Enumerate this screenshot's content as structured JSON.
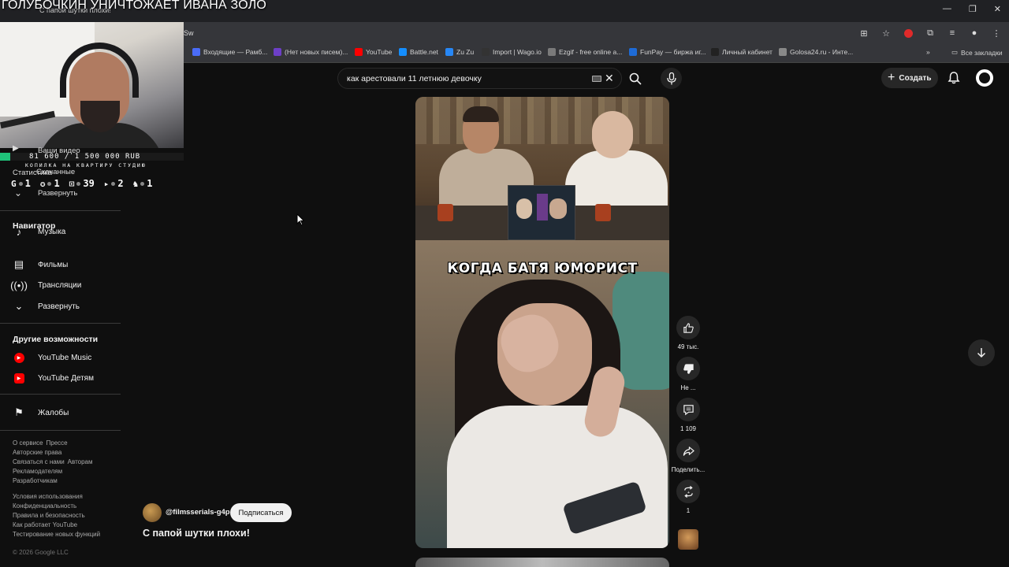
{
  "stream": {
    "title": "ГОЛУБОЧКИН УНИЧТОЖАЕТ ИВАНА ЗОЛО",
    "donation_amount": "81 600 / 1 500 000 RUB",
    "donation_progress": 0.0544,
    "donation_goal": "КОПИЛКА НА КВАРТИРУ СТУДИЮ",
    "stats": [
      {
        "icon": "G",
        "value": "1"
      },
      {
        "icon": "✪",
        "value": "1"
      },
      {
        "icon": "⊡",
        "value": "39"
      },
      {
        "icon": "▸",
        "value": "2"
      },
      {
        "icon": "♞",
        "value": "1"
      }
    ]
  },
  "browser": {
    "tab_title": "С папой шутки плохи!",
    "url": "Sw",
    "bookmarks": [
      {
        "label": "Входящие — Рамб...",
        "color": "#4a6cf7"
      },
      {
        "label": "(Нет новых писем)...",
        "color": "#6d3fc7"
      },
      {
        "label": "YouTube",
        "color": "#ff0000"
      },
      {
        "label": "Battle.net",
        "color": "#148eff"
      },
      {
        "label": "Zu Zu",
        "color": "#2787f5"
      },
      {
        "label": "Import | Wago.io",
        "color": "#333333"
      },
      {
        "label": "Ezgif - free online a...",
        "color": "#7a7a7a"
      },
      {
        "label": "FunPay — биржа иг...",
        "color": "#1e6bd6"
      },
      {
        "label": "Личный кабинет",
        "color": "#222222"
      },
      {
        "label": "Golosa24.ru - Инте...",
        "color": "#888888"
      }
    ],
    "all_bookmarks": "Все закладки"
  },
  "sidebar": {
    "your_videos": "Ваши видео",
    "stats_label": "Статистика",
    "downloads": "Скачанные",
    "expand1": "Развернуть",
    "navigator_heading": "Навигатор",
    "nav_items": [
      "Музыка",
      "Фильмы",
      "Трансляции",
      "Развернуть"
    ],
    "more_heading": "Другие возможности",
    "more_items": [
      "YouTube Music",
      "YouTube Детям"
    ],
    "report": "Жалобы",
    "footer1": [
      "О сервисе",
      "Прессе",
      "Авторские права",
      "Связаться с нами",
      "Авторам",
      "Рекламодателям",
      "Разработчикам"
    ],
    "footer2": [
      "Условия использования",
      "Конфиденциальность",
      "Правила и безопасность",
      "Как работает YouTube",
      "Тестирование новых функций"
    ],
    "copyright": "© 2026 Google LLC"
  },
  "header": {
    "search_value": "как арестовали 11 летнюю девочку",
    "create_label": "Создать"
  },
  "short": {
    "caption": "КОГДА БАТЯ ЮМОРИСТ",
    "channel": "@filmsserials-g4p",
    "subscribe": "Подписаться",
    "title": "С папой шутки плохи!",
    "likes": "49 тыс.",
    "dislike": "Не ...",
    "comments": "1 109",
    "share": "Поделить...",
    "remix": "1"
  }
}
